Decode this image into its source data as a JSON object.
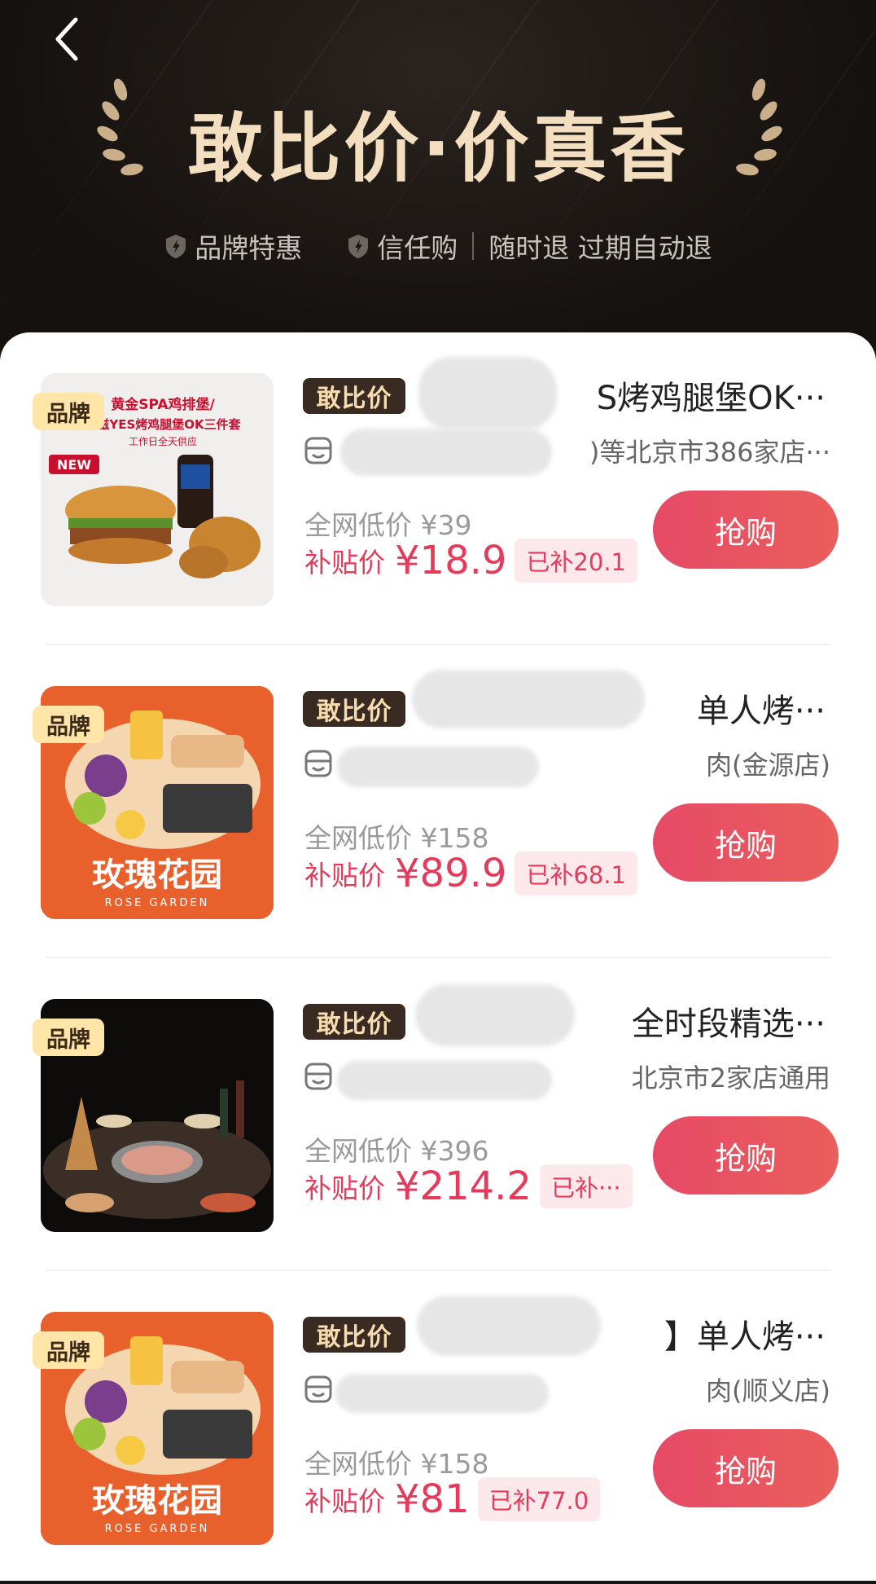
{
  "header": {
    "title": "敢比价·价真香",
    "features": [
      "品牌特惠",
      "信任购",
      "随时退 过期自动退"
    ]
  },
  "colors": {
    "accent": "#e63a5b",
    "buy_button": "#e64a66",
    "brand_tag_bg": "#ffe6a8",
    "header_bg": "#15110e",
    "title_gold": "#f3dec0"
  },
  "items": [
    {
      "brand_tag": "品牌",
      "badge": "敢比价",
      "title": "S烤鸡腿堡OK···",
      "stores": ")等北京市386家店···",
      "orig_price": "全网低价 ¥39",
      "sub_label": "补贴价",
      "sub_price": "¥18.9",
      "saved": "已补20.1",
      "buy": "抢购",
      "image": {
        "text1": "黄金SPA鸡排堡/",
        "text2": "滋滋YES烤鸡腿堡OK三件套",
        "text3": "工作日全天供应",
        "new": "NEW"
      }
    },
    {
      "brand_tag": "品牌",
      "badge": "敢比价",
      "title": "单人烤···",
      "stores": "‍肉(金源店)",
      "orig_price": "全网低价 ¥158",
      "sub_label": "补贴价",
      "sub_price": "¥89.9",
      "saved": "已补68.1",
      "buy": "抢购",
      "image": {
        "name": "玫瑰花园",
        "sub": "ROSE GARDEN"
      }
    },
    {
      "brand_tag": "品牌",
      "badge": "敢比价",
      "title": "全时段精选···",
      "stores": "北京市2家店通用",
      "orig_price": "全网低价 ¥396",
      "sub_label": "补贴价",
      "sub_price": "¥214.2",
      "saved": "已补···",
      "buy": "抢购"
    },
    {
      "brand_tag": "品牌",
      "badge": "敢比价",
      "title": "】单人烤···",
      "stores": "肉(顺义店)",
      "orig_price": "全网低价 ¥158",
      "sub_label": "补贴价",
      "sub_price": "¥81",
      "saved": "已补77.0",
      "buy": "抢购",
      "image": {
        "name": "玫瑰花园",
        "sub": "ROSE GARDEN"
      }
    }
  ]
}
